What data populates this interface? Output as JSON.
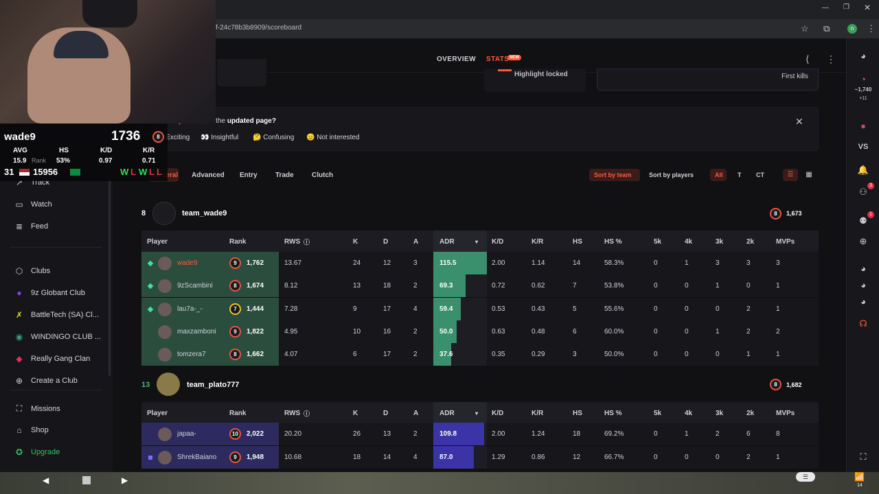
{
  "browser": {
    "url": "f-24c78b3b8909/scoreboard",
    "icons": [
      "star-icon",
      "extension-icon",
      "profile-icon",
      "menu-icon",
      "minimize-icon",
      "restore-icon",
      "close-icon"
    ],
    "profile_initial": "n"
  },
  "header": {
    "tabs": [
      {
        "label": "OVERVIEW",
        "active": false
      },
      {
        "label": "STATS",
        "active": true,
        "badge": "NEW"
      }
    ],
    "highlight_text": "Highlight locked",
    "first_kills_text": "First kills"
  },
  "overlay": {
    "name": "wade9",
    "elo": "1736",
    "elo_level": "8",
    "labels": [
      "AVG",
      "HS",
      "K/D",
      "K/R"
    ],
    "values": [
      "15.9",
      "53%",
      "0.97",
      "0.71"
    ],
    "rank_label": "Rank",
    "rank": "31",
    "points": "15956",
    "results": [
      "W",
      "L",
      "W",
      "L",
      "L"
    ]
  },
  "survey": {
    "question_prefix": "What did you think of the ",
    "question_bold": "updated page?",
    "options": [
      "Exciting",
      "Insightful",
      "Confusing",
      "Not interested"
    ],
    "option_icons": [
      "😀",
      "👀",
      "🤔",
      "😑"
    ]
  },
  "filters": {
    "tabs": [
      "General",
      "Advanced",
      "Entry",
      "Trade",
      "Clutch"
    ],
    "sort_team": "Sort by team",
    "sort_players": "Sort by players",
    "sides": [
      "All",
      "T",
      "CT"
    ]
  },
  "columns": [
    "Player",
    "Rank",
    "RWS",
    "K",
    "D",
    "A",
    "ADR",
    "K/D",
    "K/R",
    "HS",
    "HS %",
    "5k",
    "4k",
    "3k",
    "2k",
    "MVPs"
  ],
  "teams": [
    {
      "score": "8",
      "name": "team_wade9",
      "avg_elo": "1,673",
      "avg_level": "8",
      "players": [
        {
          "name": "wade9",
          "level": "9",
          "elo": "1,762",
          "rws": "13.67",
          "k": "24",
          "d": "12",
          "a": "3",
          "adr": "115.5",
          "kd": "2.00",
          "kr": "1.14",
          "hs": "14",
          "hsp": "58.3%",
          "k5": "0",
          "k4": "1",
          "k3": "3",
          "k2": "3",
          "mvps": "3",
          "adr_fill": 1.0,
          "party": true,
          "highlight": true
        },
        {
          "name": "9zScambini",
          "level": "8",
          "elo": "1,674",
          "rws": "8.12",
          "k": "13",
          "d": "18",
          "a": "2",
          "adr": "69.3",
          "kd": "0.72",
          "kr": "0.62",
          "hs": "7",
          "hsp": "53.8%",
          "k5": "0",
          "k4": "0",
          "k3": "1",
          "k2": "0",
          "mvps": "1",
          "adr_fill": 0.6,
          "party": true,
          "highlight": false
        },
        {
          "name": "lau7a-_-",
          "level": "7",
          "elo": "1,444",
          "rws": "7.28",
          "k": "9",
          "d": "17",
          "a": "4",
          "adr": "59.4",
          "kd": "0.53",
          "kr": "0.43",
          "hs": "5",
          "hsp": "55.6%",
          "k5": "0",
          "k4": "0",
          "k3": "0",
          "k2": "2",
          "mvps": "1",
          "adr_fill": 0.51,
          "party": true,
          "highlight": false
        },
        {
          "name": "maxzamboni",
          "level": "9",
          "elo": "1,822",
          "rws": "4.95",
          "k": "10",
          "d": "16",
          "a": "2",
          "adr": "50.0",
          "kd": "0.63",
          "kr": "0.48",
          "hs": "6",
          "hsp": "60.0%",
          "k5": "0",
          "k4": "0",
          "k3": "1",
          "k2": "2",
          "mvps": "2",
          "adr_fill": 0.43,
          "party": false,
          "highlight": false
        },
        {
          "name": "tomzera7",
          "level": "8",
          "elo": "1,662",
          "rws": "4.07",
          "k": "6",
          "d": "17",
          "a": "2",
          "adr": "37.6",
          "kd": "0.35",
          "kr": "0.29",
          "hs": "3",
          "hsp": "50.0%",
          "k5": "0",
          "k4": "0",
          "k3": "0",
          "k2": "1",
          "mvps": "1",
          "adr_fill": 0.33,
          "party": false,
          "highlight": false
        }
      ]
    },
    {
      "score": "13",
      "name": "team_plato777",
      "avg_elo": "1,682",
      "avg_level": "8",
      "players": [
        {
          "name": "japaa-",
          "level": "10",
          "elo": "2,022",
          "rws": "20.20",
          "k": "26",
          "d": "13",
          "a": "2",
          "adr": "109.8",
          "kd": "2.00",
          "kr": "1.24",
          "hs": "18",
          "hsp": "69.2%",
          "k5": "0",
          "k4": "1",
          "k3": "2",
          "k2": "6",
          "mvps": "8",
          "adr_fill": 0.95,
          "party": false,
          "highlight": false
        },
        {
          "name": "ShrekBaiano",
          "level": "9",
          "elo": "1,948",
          "rws": "10.68",
          "k": "18",
          "d": "14",
          "a": "4",
          "adr": "87.0",
          "kd": "1.29",
          "kr": "0.86",
          "hs": "12",
          "hsp": "66.7%",
          "k5": "0",
          "k4": "0",
          "k3": "0",
          "k2": "2",
          "mvps": "1",
          "adr_fill": 0.75,
          "party": true,
          "highlight": false
        }
      ]
    }
  ],
  "sidebar": {
    "items": [
      {
        "label": "Track",
        "icon": "track-icon",
        "glyph": "↗"
      },
      {
        "label": "Watch",
        "icon": "watch-icon",
        "glyph": "▭"
      },
      {
        "label": "Feed",
        "icon": "feed-icon",
        "glyph": "≣"
      },
      {
        "label": "Clubs",
        "icon": "clubs-icon",
        "glyph": "⬡"
      },
      {
        "label": "9z Globant Club",
        "icon": "club-9z-icon",
        "glyph": "●"
      },
      {
        "label": "BattleTech (SA) Cl...",
        "icon": "club-battletech-icon",
        "glyph": "✗"
      },
      {
        "label": "WINDINGO CLUB ...",
        "icon": "club-windingo-icon",
        "glyph": "◉"
      },
      {
        "label": "Really Gang Clan",
        "icon": "club-really-gang-icon",
        "glyph": "◆"
      },
      {
        "label": "Create a Club",
        "icon": "plus-circle-icon",
        "glyph": "⊕"
      },
      {
        "label": "Missions",
        "icon": "missions-icon",
        "glyph": "⛶"
      },
      {
        "label": "Shop",
        "icon": "shop-icon",
        "glyph": "⌂"
      },
      {
        "label": "Upgrade",
        "icon": "upgrade-icon",
        "glyph": "✪"
      }
    ]
  },
  "rail": {
    "level_count": "~1,740",
    "level_delta": "+11",
    "vs_label": "VS",
    "notif_badge": "3",
    "badge2": "1",
    "tray_count": "14"
  },
  "colors": {
    "accent": "#ff5a36",
    "team_a": "#2b4d3e",
    "team_b": "#2c2a5e",
    "adr_a": "#3a8f6c",
    "adr_b": "#3b34a6",
    "upgrade": "#35c16b"
  }
}
